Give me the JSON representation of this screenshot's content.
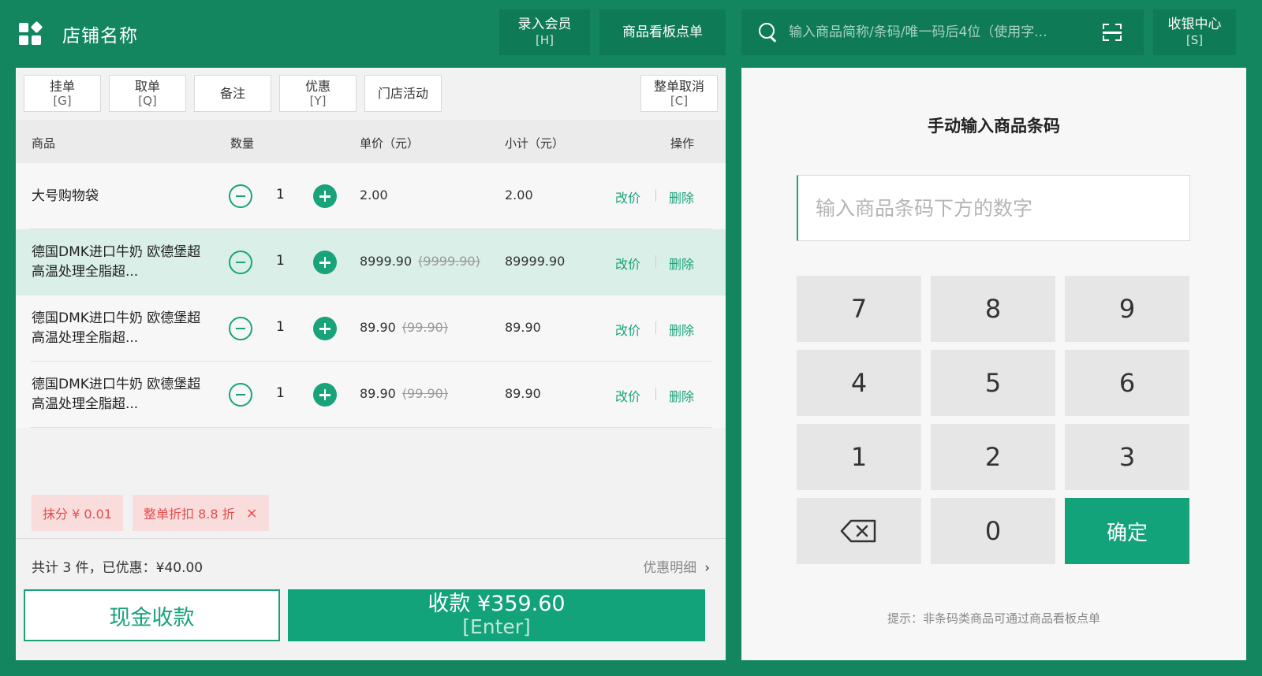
{
  "header": {
    "store_name": "店铺名称",
    "member_button": {
      "label": "录入会员",
      "key": "[H]"
    },
    "board_button": {
      "label": "商品看板点单"
    },
    "search": {
      "placeholder": "输入商品简称/条码/唯一码后4位（使用字..."
    },
    "cashier_button": {
      "label": "收银中心",
      "key": "[S]"
    },
    "icons": {
      "logo": "grid-logo-icon",
      "search": "search-icon",
      "scan": "scan-icon"
    }
  },
  "toolbar": {
    "hold": {
      "label": "挂单",
      "key": "[G]"
    },
    "retrieve": {
      "label": "取单",
      "key": "[Q]"
    },
    "note": {
      "label": "备注"
    },
    "discount": {
      "label": "优惠",
      "key": "[Y]"
    },
    "activity": {
      "label": "门店活动"
    },
    "cancel_all": {
      "label": "整单取消",
      "key": "[C]"
    }
  },
  "table": {
    "headers": {
      "product": "商品",
      "qty": "数量",
      "unit_price": "单价（元）",
      "subtotal": "小计（元）",
      "actions": "操作"
    },
    "rows": [
      {
        "name": "大号购物袋",
        "qty": "1",
        "price": "2.00",
        "original_price": "",
        "subtotal": "2.00",
        "edit": "改价",
        "delete": "删除",
        "selected": false
      },
      {
        "name": "德国DMK进口牛奶 欧德堡超高温处理全脂超...",
        "qty": "1",
        "price": "8999.90",
        "original_price": "(9999.90)",
        "subtotal": "89999.90",
        "edit": "改价",
        "delete": "删除",
        "selected": true
      },
      {
        "name": "德国DMK进口牛奶 欧德堡超高温处理全脂超...",
        "qty": "1",
        "price": "89.90",
        "original_price": "(99.90)",
        "subtotal": "89.90",
        "edit": "改价",
        "delete": "删除",
        "selected": false
      },
      {
        "name": "德国DMK进口牛奶 欧德堡超高温处理全脂超...",
        "qty": "1",
        "price": "89.90",
        "original_price": "(99.90)",
        "subtotal": "89.90",
        "edit": "改价",
        "delete": "删除",
        "selected": false
      }
    ]
  },
  "tags": {
    "rounding": "抹分 ¥ 0.01",
    "order_discount": "整单折扣 8.8 折",
    "close": "×"
  },
  "summary": {
    "text": "共计 3 件，已优惠：¥40.00",
    "detail_link": "优惠明细",
    "chevron": "›"
  },
  "actions": {
    "cash": "现金收款",
    "pay": "收款 ¥359.60",
    "pay_key": "[Enter]"
  },
  "keypad": {
    "title": "手动输入商品条码",
    "placeholder": "输入商品条码下方的数字",
    "keys": [
      "7",
      "8",
      "9",
      "4",
      "5",
      "6",
      "1",
      "2",
      "3"
    ],
    "zero": "0",
    "confirm": "确定",
    "backspace_icon": "backspace-icon",
    "hint": "提示：非条码类商品可通过商品看板点单"
  },
  "colors": {
    "brand_green": "#13865f",
    "accent_green": "#13a37a",
    "selected_row": "#d9efe7",
    "tag_bg": "#f9dcdc",
    "tag_text": "#e84c4c"
  }
}
